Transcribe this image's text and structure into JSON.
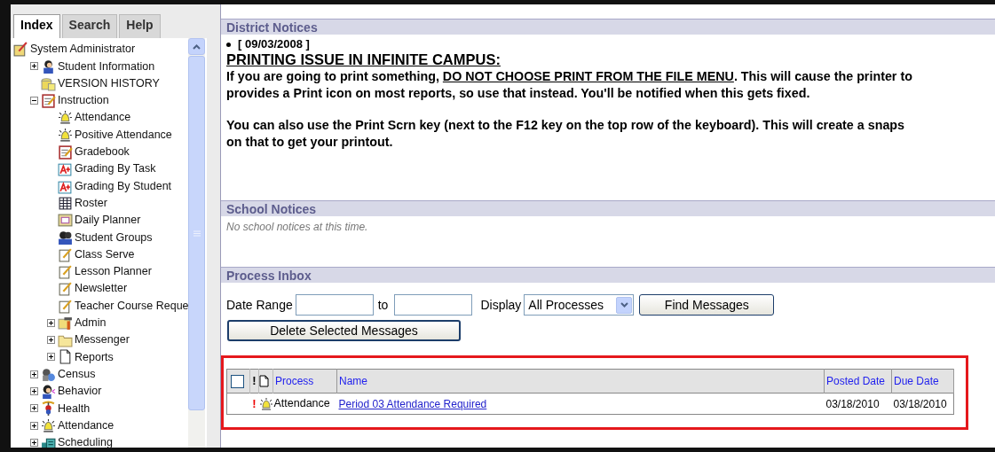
{
  "sidebar": {
    "tabs": [
      {
        "label": "Index",
        "selected": true
      },
      {
        "label": "Search",
        "selected": false
      },
      {
        "label": "Help",
        "selected": false
      }
    ],
    "tree": [
      {
        "label": "System Administrator",
        "kind": "admin",
        "children": [
          {
            "label": "Student Information",
            "kind": "student",
            "expanded": false
          },
          {
            "label": "VERSION HISTORY",
            "kind": "coins"
          },
          {
            "label": "Instruction",
            "kind": "notebook",
            "expanded": true,
            "children": [
              {
                "label": "Attendance",
                "kind": "bell"
              },
              {
                "label": "Positive Attendance",
                "kind": "bell"
              },
              {
                "label": "Gradebook",
                "kind": "notebook"
              },
              {
                "label": "Grading By Task",
                "kind": "grade"
              },
              {
                "label": "Grading By Student",
                "kind": "grade"
              },
              {
                "label": "Roster",
                "kind": "roster"
              },
              {
                "label": "Daily Planner",
                "kind": "planner"
              },
              {
                "label": "Student Groups",
                "kind": "groups"
              },
              {
                "label": "Class Serve",
                "kind": "note"
              },
              {
                "label": "Lesson Planner",
                "kind": "note"
              },
              {
                "label": "Newsletter",
                "kind": "note"
              },
              {
                "label": "Teacher Course Reque",
                "kind": "note"
              },
              {
                "label": "Admin",
                "kind": "tools",
                "expanded": false
              },
              {
                "label": "Messenger",
                "kind": "folder",
                "expanded": false
              },
              {
                "label": "Reports",
                "kind": "page",
                "expanded": false
              }
            ]
          },
          {
            "label": "Census",
            "kind": "census",
            "expanded": false
          },
          {
            "label": "Behavior",
            "kind": "behavior",
            "expanded": false
          },
          {
            "label": "Health",
            "kind": "health",
            "expanded": false
          },
          {
            "label": "Attendance",
            "kind": "bell",
            "expanded": false
          },
          {
            "label": "Scheduling",
            "kind": "scheduling",
            "expanded": false
          }
        ]
      }
    ]
  },
  "district_notices": {
    "title": "District Notices",
    "date": "[ 09/03/2008 ]",
    "heading": "PRINTING ISSUE IN INFINITE CAMPUS:",
    "paragraphs": [
      [
        [
          {
            "text": "If you are going to print something, ",
            "underline": false
          },
          {
            "text": "DO NOT CHOOSE PRINT FROM THE FILE MENU",
            "underline": true
          },
          {
            "text": ". This will cause the printer to",
            "underline": false
          }
        ],
        [
          {
            "text": "provides a Print icon on most reports, so use that instead.  You'll be notified when this gets fixed.",
            "underline": false
          }
        ]
      ],
      [
        [
          {
            "text": "You can also use the Print Scrn key (next to the F12 key on the top row of the keyboard). This will create a snaps",
            "underline": false
          }
        ],
        [
          {
            "text": "on that to get your printout.",
            "underline": false
          }
        ]
      ]
    ]
  },
  "school_notices": {
    "title": "School Notices",
    "message": "No school notices at this time."
  },
  "process_inbox": {
    "title": "Process Inbox",
    "date_range_label": "Date Range",
    "to_label": "to",
    "display_label": "Display",
    "display_value": "All Processes",
    "find_button": "Find Messages",
    "delete_button": "Delete Selected Messages",
    "table": {
      "columns": [
        "!",
        "Process",
        "Name",
        "Posted Date",
        "Due Date"
      ],
      "select_all_checked": false,
      "rows": [
        {
          "priority": "!",
          "process": "Attendance",
          "name": "Period 03 Attendance Required",
          "posted_date": "03/18/2010",
          "due_date": "03/18/2010"
        }
      ]
    }
  }
}
